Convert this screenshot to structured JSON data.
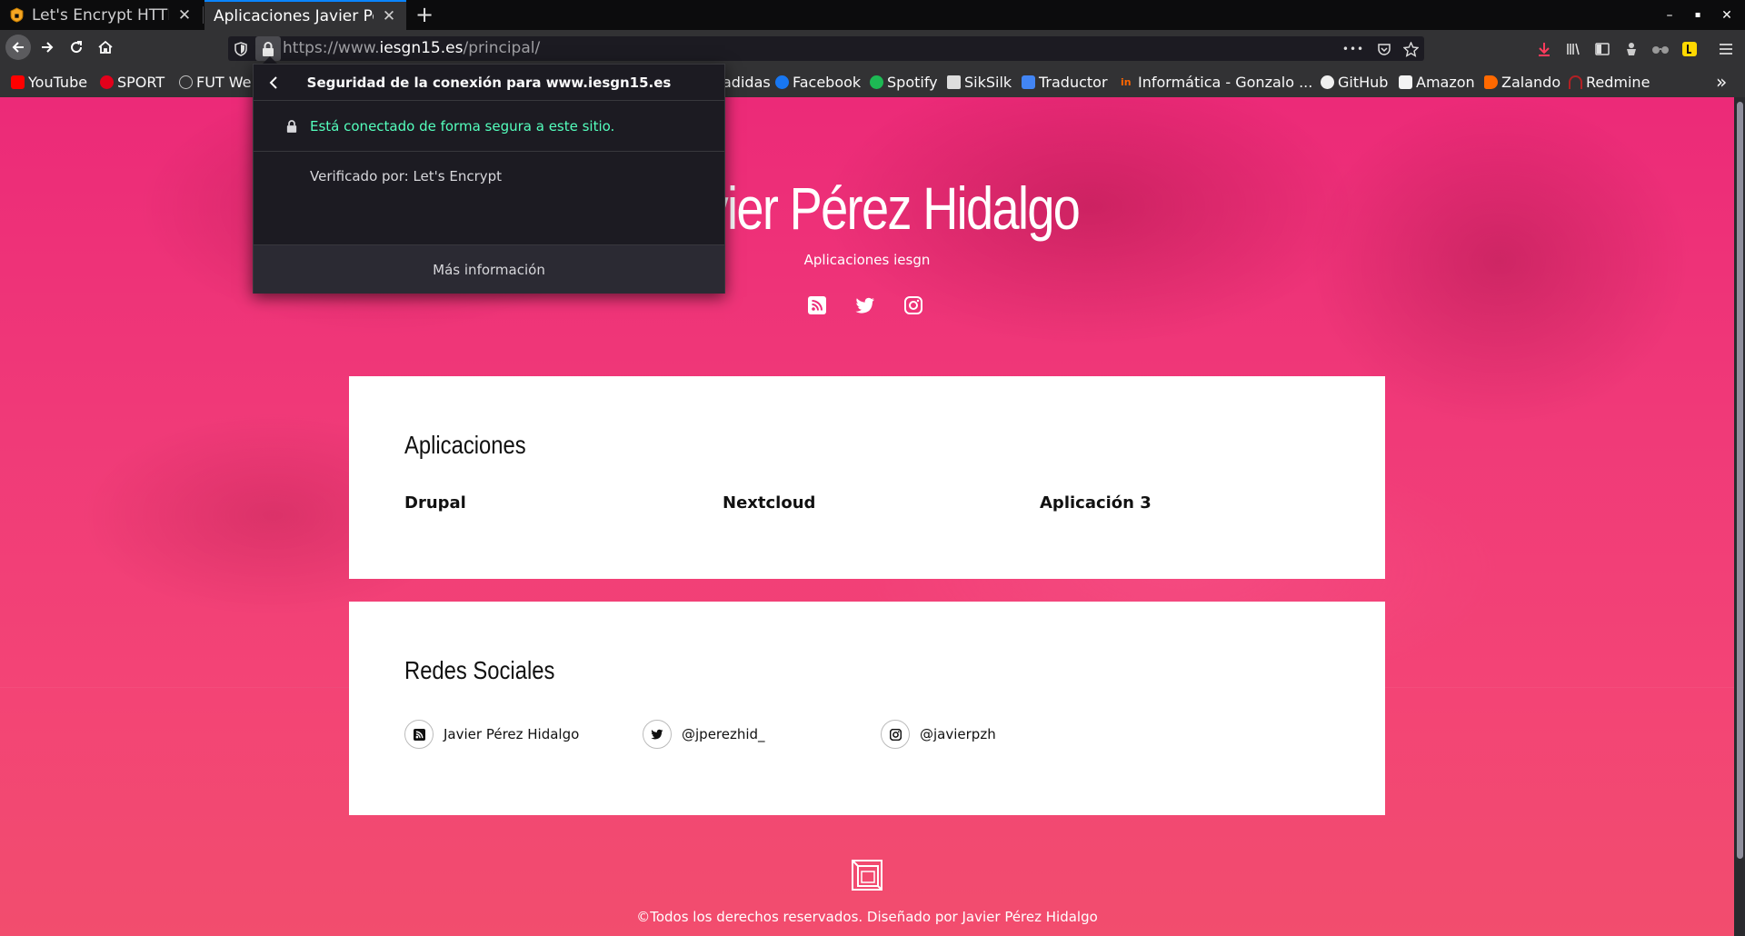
{
  "browser": {
    "tabs": [
      {
        "title": "Let's Encrypt HTTPS",
        "close": "✕"
      },
      {
        "title": "Aplicaciones Javier Pérez",
        "close": "✕"
      }
    ],
    "new_tab": "+",
    "window_controls": {
      "minimize": "–",
      "maximize": "▪",
      "close": "✕"
    },
    "url": {
      "prefix": "https://www.",
      "host": "iesgn15.es",
      "path": "/principal/"
    },
    "page_actions": "•••",
    "bookmarks": [
      {
        "label": "YouTube",
        "color": "#ff0000"
      },
      {
        "label": "SPORT",
        "color": "#e3001b"
      },
      {
        "label": "FUT We",
        "color": "#c0c0c0"
      },
      {
        "label": "adidas",
        "color": "#323234"
      },
      {
        "label": "Facebook",
        "color": "#1877f2"
      },
      {
        "label": "Spotify",
        "color": "#1db954"
      },
      {
        "label": "SikSilk",
        "color": "#dddddd"
      },
      {
        "label": "Traductor",
        "color": "#4285f4"
      },
      {
        "label": "Informática - Gonzalo ...",
        "color": "#ff6600"
      },
      {
        "label": "GitHub",
        "color": "#f0f0f0"
      },
      {
        "label": "Amazon",
        "color": "#f3f3f3"
      },
      {
        "label": "Zalando",
        "color": "#ff6900"
      },
      {
        "label": "Redmine",
        "color": "#b32024"
      }
    ],
    "bookmarks_overflow": "»"
  },
  "popup": {
    "title": "Seguridad de la conexión para www.iesgn15.es",
    "secure_text": "Está conectado de forma segura a este sitio.",
    "verified_by": "Verificado por: Let's Encrypt",
    "more_info": "Más información"
  },
  "site": {
    "title": "Javier Pérez Hidalgo",
    "subtitle": "Aplicaciones iesgn",
    "apps_section": {
      "title": "Aplicaciones",
      "items": [
        "Drupal",
        "Nextcloud",
        "Aplicación 3"
      ]
    },
    "social_section": {
      "title": "Redes Sociales",
      "items": [
        {
          "icon": "rss-icon",
          "label": "Javier Pérez Hidalgo"
        },
        {
          "icon": "twitter-icon",
          "label": "@jperezhid_"
        },
        {
          "icon": "instagram-icon",
          "label": "@javierpzh"
        }
      ]
    },
    "footer": "©Todos los derechos reservados. Diseñado por Javier Pérez Hidalgo"
  },
  "colors": {
    "accent": "#0a84ff",
    "secure_green": "#54ffbd",
    "hero_pink": "#ec2a78"
  }
}
